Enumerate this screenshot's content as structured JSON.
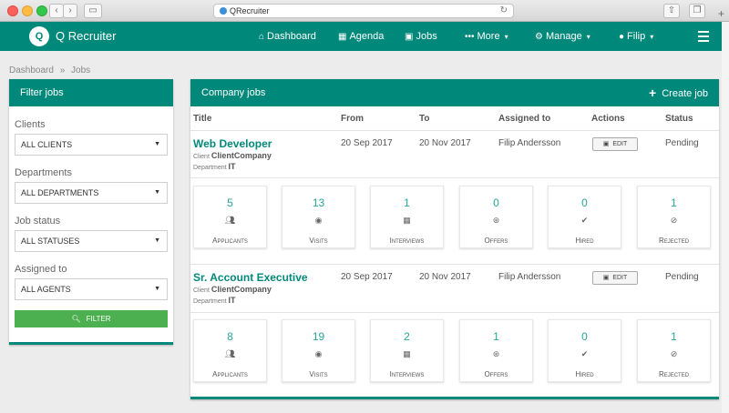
{
  "browser": {
    "url": "QRecruiter"
  },
  "app": {
    "logo_letter": "Q",
    "brand": "Q Recruiter",
    "nav": [
      {
        "label": "Dashboard",
        "icon": "home-icon"
      },
      {
        "label": "Agenda",
        "icon": "calendar-icon"
      },
      {
        "label": "Jobs",
        "icon": "briefcase-icon"
      },
      {
        "label": "More",
        "icon": "dots-icon"
      },
      {
        "label": "Manage",
        "icon": "gears-icon"
      },
      {
        "label": "Filip",
        "icon": "user-icon"
      }
    ]
  },
  "breadcrumb": {
    "home": "Dashboard",
    "separator": "»",
    "current": "Jobs"
  },
  "filter": {
    "title": "Filter jobs",
    "fields": [
      {
        "label": "Clients",
        "value": "ALL CLIENTS"
      },
      {
        "label": "Departments",
        "value": "ALL DEPARTMENTS"
      },
      {
        "label": "Job status",
        "value": "ALL STATUSES"
      },
      {
        "label": "Assigned to",
        "value": "ALL AGENTS"
      }
    ],
    "button": "FILTER"
  },
  "jobs": {
    "title": "Company jobs",
    "create_label": "Create job",
    "columns": [
      "Title",
      "From",
      "To",
      "Assigned to",
      "Actions",
      "Status"
    ],
    "client_label": "Client",
    "department_label": "Department",
    "edit_label": "EDIT",
    "rows": [
      {
        "title": "Web Developer",
        "client": "ClientCompany",
        "department": "IT",
        "from": "20 Sep 2017",
        "to": "20 Nov 2017",
        "assigned": "Filip Andersson",
        "status": "Pending",
        "stats": [
          {
            "num": "5",
            "label": "Applicants",
            "icon": "users-icon"
          },
          {
            "num": "13",
            "label": "Visits",
            "icon": "eye-icon"
          },
          {
            "num": "1",
            "label": "Interviews",
            "icon": "calendar-icon"
          },
          {
            "num": "0",
            "label": "Offers",
            "icon": "handshake-icon"
          },
          {
            "num": "0",
            "label": "Hired",
            "icon": "check-icon"
          },
          {
            "num": "1",
            "label": "Rejected",
            "icon": "ban-icon"
          }
        ]
      },
      {
        "title": "Sr. Account Executive",
        "client": "ClientCompany",
        "department": "IT",
        "from": "20 Sep 2017",
        "to": "20 Nov 2017",
        "assigned": "Filip Andersson",
        "status": "Pending",
        "stats": [
          {
            "num": "8",
            "label": "Applicants",
            "icon": "users-icon"
          },
          {
            "num": "19",
            "label": "Visits",
            "icon": "eye-icon"
          },
          {
            "num": "2",
            "label": "Interviews",
            "icon": "calendar-icon"
          },
          {
            "num": "1",
            "label": "Offers",
            "icon": "handshake-icon"
          },
          {
            "num": "0",
            "label": "Hired",
            "icon": "check-icon"
          },
          {
            "num": "1",
            "label": "Rejected",
            "icon": "ban-icon"
          }
        ]
      }
    ]
  },
  "colors": {
    "primary": "#00897b",
    "accent_number": "#26a69a",
    "filter_button": "#4caf50"
  }
}
